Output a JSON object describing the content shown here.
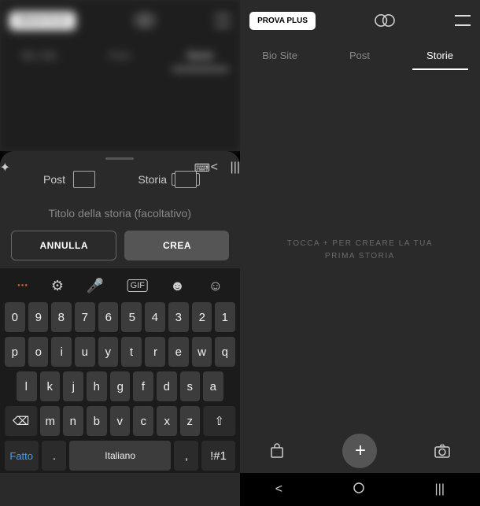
{
  "header": {
    "plus_label": "PROVA PLUS"
  },
  "tabs": [
    "Storie",
    "Post",
    "Bio Site"
  ],
  "empty": {
    "line1": "TOCCA + PER CREARE LA TUA",
    "line2": "PRIMA STORIA"
  },
  "sheet": {
    "type_story": "Storia",
    "type_post": "Post",
    "title_placeholder": "Titolo della storia (facoltativo)",
    "create": "CREA",
    "cancel": "ANNULLA"
  },
  "keyboard": {
    "row1": [
      "1",
      "2",
      "3",
      "4",
      "5",
      "6",
      "7",
      "8",
      "9",
      "0"
    ],
    "row2": [
      "q",
      "w",
      "e",
      "r",
      "t",
      "y",
      "u",
      "i",
      "o",
      "p"
    ],
    "row3": [
      "a",
      "s",
      "d",
      "f",
      "g",
      "h",
      "j",
      "k",
      "l"
    ],
    "row4": [
      "z",
      "x",
      "c",
      "v",
      "b",
      "n",
      "m"
    ],
    "shift": "⇧",
    "backspace": "⌫",
    "symbols": "!#1",
    "lang": "Italiano",
    "done": "Fatto"
  }
}
